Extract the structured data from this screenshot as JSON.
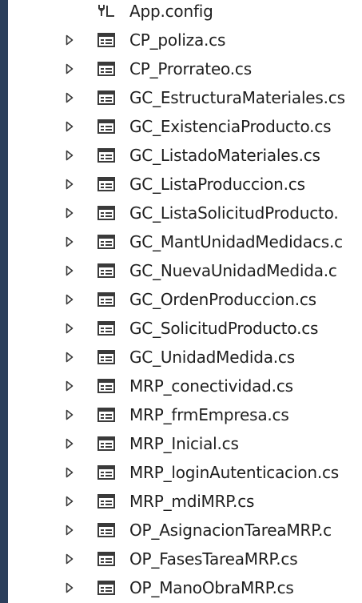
{
  "explorer": {
    "config_item": {
      "label": "App.config",
      "icon": "config-file-icon"
    },
    "files": [
      {
        "label": "CP_poliza.cs"
      },
      {
        "label": "CP_Prorrateo.cs"
      },
      {
        "label": "GC_EstructuraMateriales.cs"
      },
      {
        "label": "GC_ExistenciaProducto.cs"
      },
      {
        "label": "GC_ListadoMateriales.cs"
      },
      {
        "label": "GC_ListaProduccion.cs"
      },
      {
        "label": "GC_ListaSolicitudProducto."
      },
      {
        "label": "GC_MantUnidadMedidacs.c"
      },
      {
        "label": "GC_NuevaUnidadMedida.c"
      },
      {
        "label": "GC_OrdenProduccion.cs"
      },
      {
        "label": "GC_SolicitudProducto.cs"
      },
      {
        "label": "GC_UnidadMedida.cs"
      },
      {
        "label": "MRP_conectividad.cs"
      },
      {
        "label": "MRP_frmEmpresa.cs"
      },
      {
        "label": "MRP_Inicial.cs"
      },
      {
        "label": "MRP_loginAutenticacion.cs"
      },
      {
        "label": "MRP_mdiMRP.cs"
      },
      {
        "label": "OP_AsignacionTareaMRP.c"
      },
      {
        "label": "OP_FasesTareaMRP.cs"
      },
      {
        "label": "OP_ManoObraMRP.cs"
      }
    ],
    "file_icon": "form-file-icon",
    "expander_icon": "expand-triangle-icon",
    "colors": {
      "left_bar": "#2b3f5c",
      "text": "#1e1e1e",
      "icon": "#3a3a3a"
    }
  }
}
